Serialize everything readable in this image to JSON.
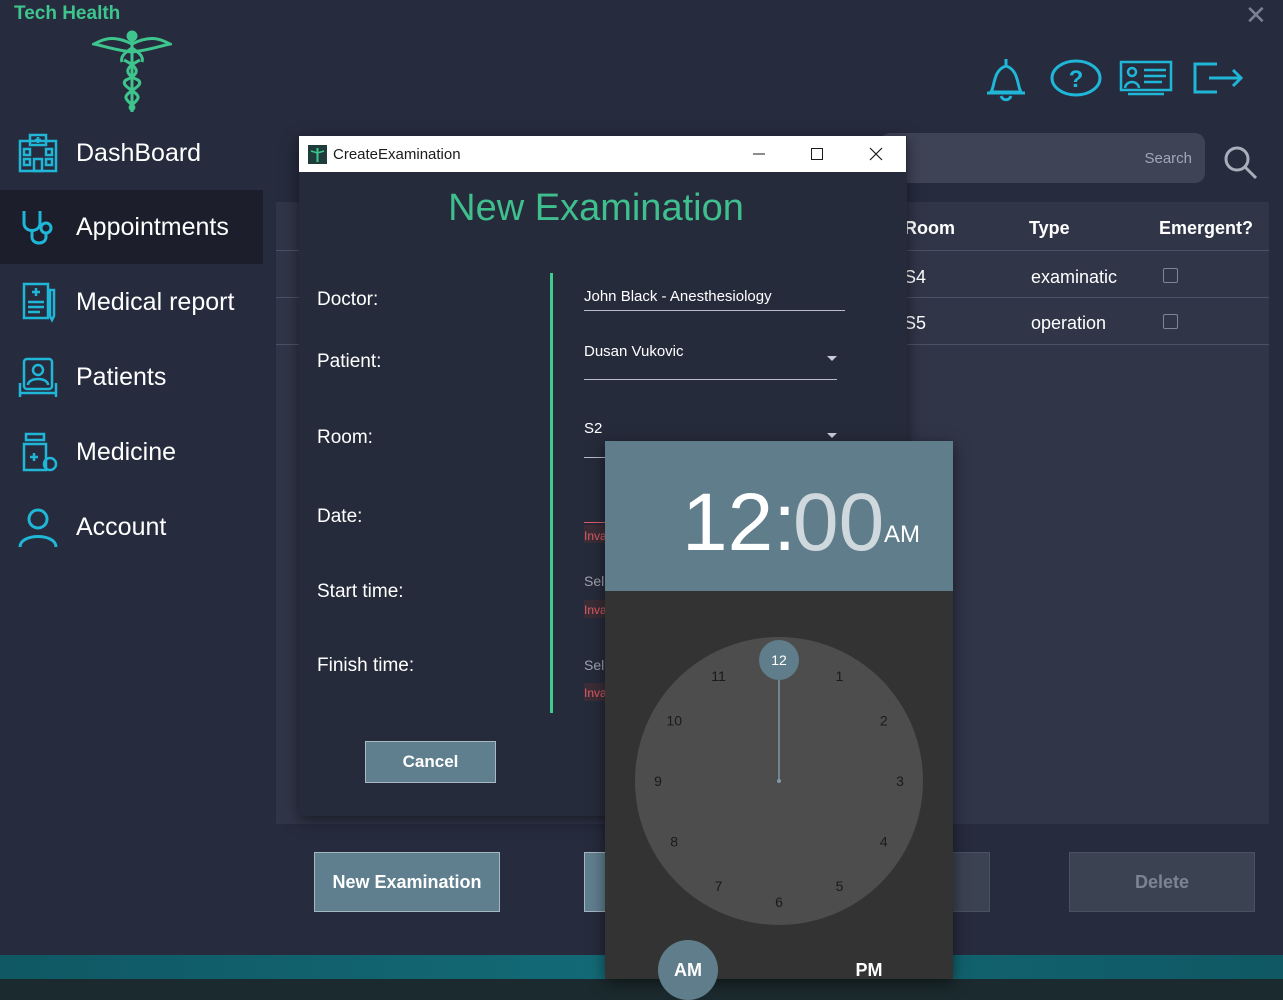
{
  "app": {
    "brand": "Tech Health",
    "close_glyph": "✕"
  },
  "top_icons": [
    "bell-icon",
    "help-icon",
    "presentation-icon",
    "logout-icon"
  ],
  "sidebar": {
    "items": [
      {
        "label": "DashBoard",
        "icon": "hospital-icon",
        "active": false
      },
      {
        "label": "Appointments",
        "icon": "stethoscope-icon",
        "active": true
      },
      {
        "label": "Medical report",
        "icon": "medical-report-icon",
        "active": false
      },
      {
        "label": "Patients",
        "icon": "patient-icon",
        "active": false
      },
      {
        "label": "Medicine",
        "icon": "medicine-icon",
        "active": false
      },
      {
        "label": "Account",
        "icon": "account-icon",
        "active": false
      }
    ]
  },
  "search": {
    "label": "Search"
  },
  "table": {
    "headers": {
      "room": "Room",
      "type": "Type",
      "emergent": "Emergent?"
    },
    "rows": [
      {
        "room": "S4",
        "type": "examinatic",
        "emergent": false
      },
      {
        "room": "S5",
        "type": "operation",
        "emergent": false
      }
    ]
  },
  "buttons": {
    "new_examination": "New Examination",
    "delete": "Delete"
  },
  "dialog": {
    "window_title": "CreateExamination",
    "heading": "New Examination",
    "labels": {
      "doctor": "Doctor:",
      "patient": "Patient:",
      "room": "Room:",
      "date": "Date:",
      "start": "Start  time:",
      "finish": "Finish time:"
    },
    "values": {
      "doctor": "John Black - Anesthesiology",
      "patient": "Dusan Vukovic",
      "room": "S2",
      "start_partial": "Sel",
      "finish_partial": "Sel",
      "invalid": "Inva"
    },
    "cancel": "Cancel"
  },
  "time_picker": {
    "hour": "12",
    "separator": ":",
    "minute": "00",
    "period": "AM",
    "selected_hour": 12,
    "clock_numbers": [
      "12",
      "1",
      "2",
      "3",
      "4",
      "5",
      "6",
      "7",
      "8",
      "9",
      "10",
      "11"
    ],
    "am_label": "AM",
    "pm_label": "PM",
    "selected_period": "AM"
  }
}
